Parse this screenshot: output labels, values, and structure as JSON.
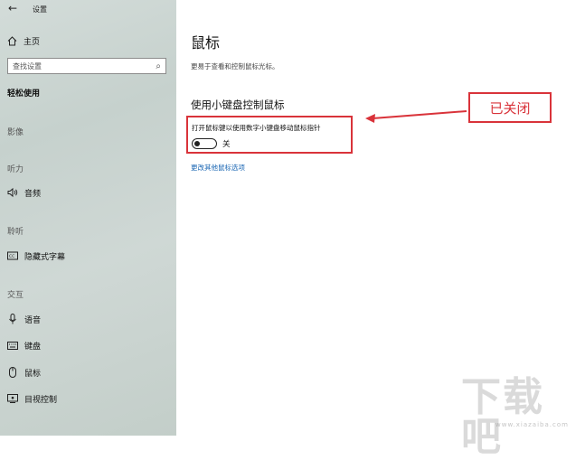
{
  "window": {
    "title": "设置"
  },
  "sidebar": {
    "home_label": "主页",
    "search_placeholder": "查找设置",
    "section_title": "轻松使用",
    "groups": [
      {
        "heading": "影像"
      },
      {
        "heading": "听力",
        "items": [
          {
            "label": "音频",
            "icon": "speaker-icon"
          }
        ]
      },
      {
        "heading": "聆听",
        "items": [
          {
            "label": "隐藏式字幕",
            "icon": "closed-caption-icon"
          }
        ]
      },
      {
        "heading": "交互",
        "items": [
          {
            "label": "语音",
            "icon": "microphone-icon"
          },
          {
            "label": "键盘",
            "icon": "keyboard-icon"
          },
          {
            "label": "鼠标",
            "icon": "mouse-icon"
          },
          {
            "label": "目视控制",
            "icon": "eye-control-icon"
          }
        ]
      }
    ]
  },
  "main": {
    "title": "鼠标",
    "description": "更易于查看和控制鼠标光标。",
    "section_title": "使用小键盘控制鼠标",
    "toggle": {
      "label": "打开鼠标键以使用数字小键盘移动鼠标指针",
      "state_text": "关",
      "on": false
    },
    "link_text": "更改其他鼠标选项"
  },
  "annotation": {
    "callout_text": "已关闭",
    "color": "#d9333a"
  },
  "watermark": {
    "text": "下载吧",
    "url": "www.xiazaiba.com"
  }
}
